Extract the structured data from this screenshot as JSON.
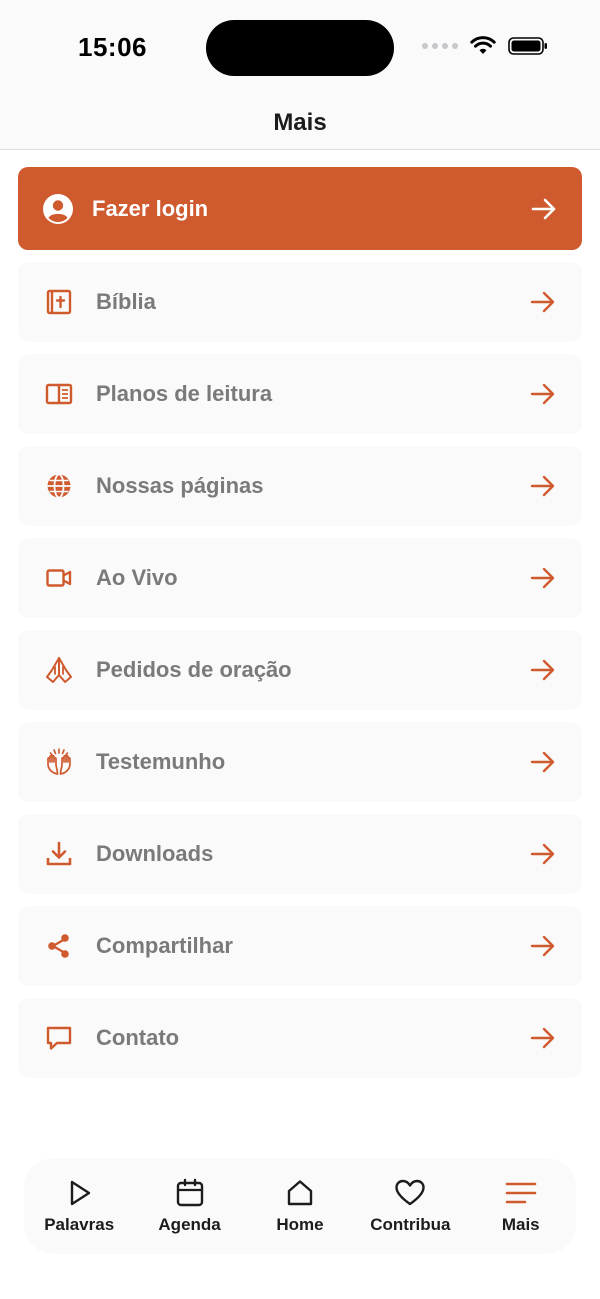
{
  "status_bar": {
    "time": "15:06"
  },
  "header": {
    "title": "Mais"
  },
  "login": {
    "label": "Fazer login"
  },
  "menu": {
    "items": [
      {
        "label": "Bíblia",
        "icon": "bible-icon"
      },
      {
        "label": "Planos de leitura",
        "icon": "book-open-icon"
      },
      {
        "label": "Nossas páginas",
        "icon": "globe-icon"
      },
      {
        "label": "Ao Vivo",
        "icon": "video-camera-icon"
      },
      {
        "label": "Pedidos de oração",
        "icon": "praying-hands-icon"
      },
      {
        "label": "Testemunho",
        "icon": "raised-hands-icon"
      },
      {
        "label": "Downloads",
        "icon": "download-icon"
      },
      {
        "label": "Compartilhar",
        "icon": "share-icon"
      },
      {
        "label": "Contato",
        "icon": "chat-bubble-icon"
      }
    ]
  },
  "tabs": {
    "items": [
      {
        "label": "Palavras",
        "icon": "play-icon"
      },
      {
        "label": "Agenda",
        "icon": "calendar-icon"
      },
      {
        "label": "Home",
        "icon": "home-icon"
      },
      {
        "label": "Contribua",
        "icon": "heart-icon"
      },
      {
        "label": "Mais",
        "icon": "menu-icon"
      }
    ],
    "active": "Mais"
  },
  "colors": {
    "accent": "#CF5A2E",
    "card": "#FAFAFA",
    "text_muted": "#7A7A7A"
  }
}
